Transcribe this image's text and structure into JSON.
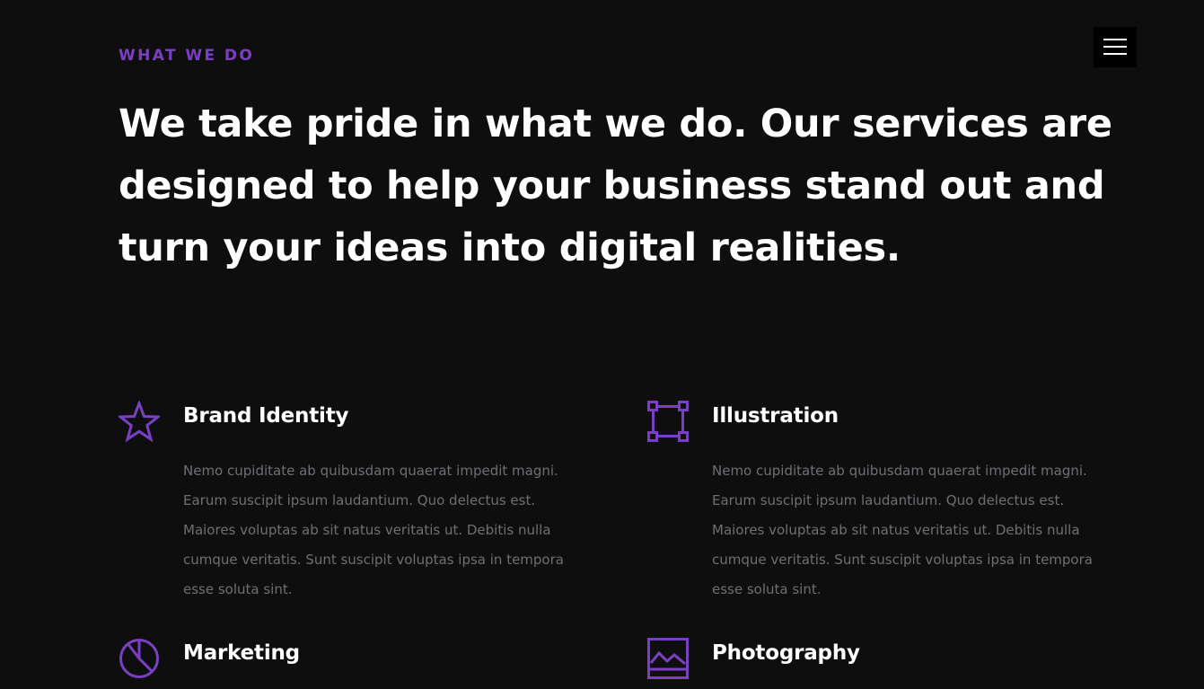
{
  "header": {
    "menu_icon": "hamburger-menu-icon"
  },
  "intro": {
    "label": "WHAT WE DO",
    "headline": "We take pride in what we do. Our services are designed to help your business stand out and turn your ideas into digital realities."
  },
  "colors": {
    "background": "#0e0e0f",
    "accent": "#7b3fc4",
    "text_primary": "#ffffff",
    "text_muted": "#6f6f74"
  },
  "services": [
    {
      "title": "Brand Identity",
      "icon": "star-icon",
      "description": "Nemo cupiditate ab quibusdam quaerat impedit magni. Earum suscipit ipsum laudantium. Quo delectus est. Maiores voluptas ab sit natus veritatis ut. Debitis nulla cumque veritatis. Sunt suscipit voluptas ipsa in tempora esse soluta sint."
    },
    {
      "title": "Illustration",
      "icon": "vector-square-icon",
      "description": "Nemo cupiditate ab quibusdam quaerat impedit magni. Earum suscipit ipsum laudantium. Quo delectus est. Maiores voluptas ab sit natus veritatis ut. Debitis nulla cumque veritatis. Sunt suscipit voluptas ipsa in tempora esse soluta sint."
    },
    {
      "title": "Marketing",
      "icon": "pie-chart-icon",
      "description": ""
    },
    {
      "title": "Photography",
      "icon": "image-icon",
      "description": ""
    }
  ]
}
